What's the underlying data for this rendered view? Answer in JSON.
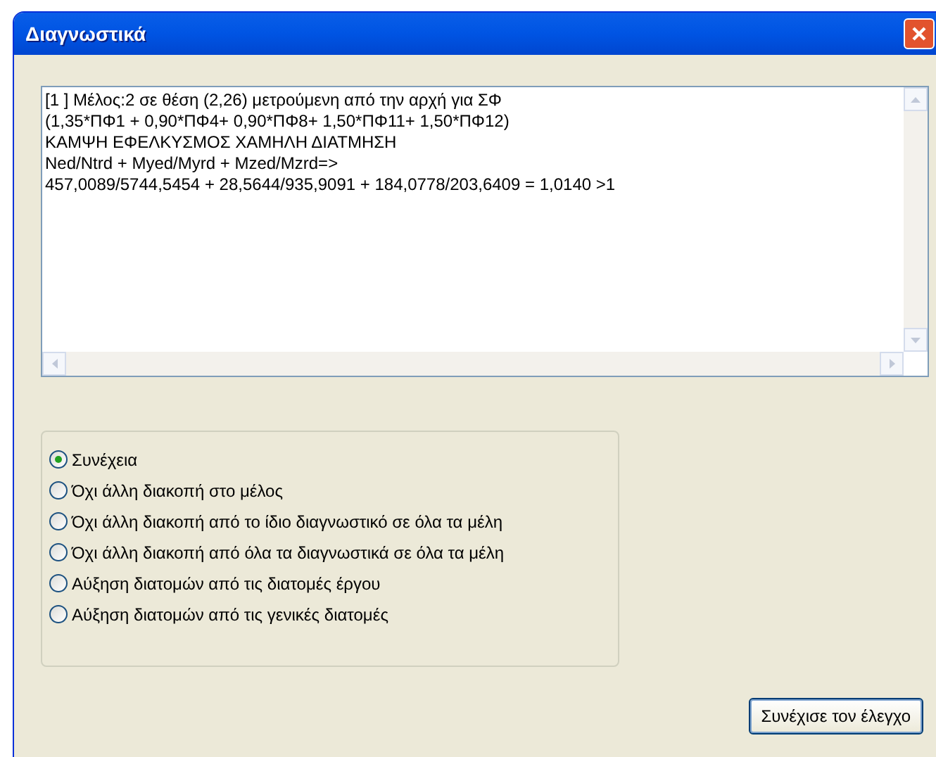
{
  "window": {
    "title": "Διαγνωστικά"
  },
  "report": {
    "lines": [
      "[1 ] Μέλος:2  σε θέση  (2,26)  μετρούμενη από την αρχή για ΣΦ",
      "(1,35*ΠΦ1 + 0,90*ΠΦ4+ 0,90*ΠΦ8+ 1,50*ΠΦ11+ 1,50*ΠΦ12)",
      "ΚΑΜΨΗ ΕΦΕΛΚΥΣΜΟΣ ΧΑΜΗΛΗ ΔΙΑΤΜΗΣΗ",
      "Ned/Ntrd + Myed/Myrd + Mzed/Mzrd=>",
      "457,0089/5744,5454 + 28,5644/935,9091 + 184,0778/203,6409 = 1,0140 >1"
    ]
  },
  "options": [
    {
      "label": "Συνέχεια",
      "selected": true
    },
    {
      "label": "Όχι άλλη διακοπή στο μέλος",
      "selected": false
    },
    {
      "label": "Όχι άλλη διακοπή από το ίδιο διαγνωστικό σε όλα τα μέλη",
      "selected": false
    },
    {
      "label": "Όχι άλλη διακοπή από όλα τα διαγνωστικά σε όλα τα μέλη",
      "selected": false
    },
    {
      "label": "Αύξηση διατομών από τις διατομές έργου",
      "selected": false
    },
    {
      "label": "Αύξηση διατομών από τις γενικές διατομές",
      "selected": false
    }
  ],
  "button": "Συνέχισε τον έλεγχο"
}
